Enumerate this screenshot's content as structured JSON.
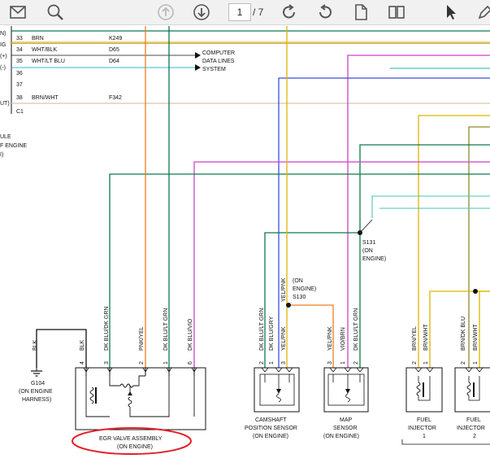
{
  "toolbar": {
    "current_page": "1",
    "total_pages": "/ 7",
    "icons": [
      "mail-icon",
      "zoom-icon",
      "page-up-icon",
      "page-down-icon",
      "rotate-clockwise-icon",
      "rotate-counterclockwise-icon",
      "single-page-icon",
      "two-page-icon",
      "select-cursor-icon",
      "pen-icon"
    ]
  },
  "colors": {
    "brn": "#c8a878",
    "green": "#0a7a4a",
    "orange": "#f07c20",
    "blue": "#3a4fd8",
    "magenta": "#d040c8",
    "yellow": "#e0b400",
    "olive": "#8a8a30",
    "teal": "#40c8b8",
    "cyan": "#30b8d8",
    "black": "#111111",
    "circle": "#e0202a"
  },
  "connector": {
    "left_pin_labels": [
      "N)",
      "IG",
      "(+)",
      "(-)",
      "",
      "",
      "UT)"
    ],
    "rows": [
      {
        "pin": "33",
        "color": "BRN",
        "circuit": "K249"
      },
      {
        "pin": "34",
        "color": "WHT/BLK",
        "circuit": "D65"
      },
      {
        "pin": "35",
        "color": "WHT/LT BLU",
        "circuit": "D64"
      },
      {
        "pin": "36",
        "color": "",
        "circuit": ""
      },
      {
        "pin": "37",
        "color": "",
        "circuit": ""
      },
      {
        "pin": "38",
        "color": "BRN/WHT",
        "circuit": "F342"
      }
    ],
    "connector_id": "C1",
    "module_text": [
      "ULE",
      "F ENGINE",
      "I)"
    ]
  },
  "computer_data_lines": [
    "COMPUTER",
    "DATA LINES",
    "SYSTEM"
  ],
  "splices": {
    "s131": [
      "S131",
      "(ON",
      "ENGINE)"
    ],
    "s130": [
      "(ON",
      "ENGINE)",
      "S130"
    ]
  },
  "ground": {
    "wire": "BLK",
    "id": "G104",
    "loc": [
      "(ON ENGINE",
      "HARNESS)"
    ]
  },
  "egr": {
    "pins": [
      {
        "num": "4",
        "wire": "BLK"
      },
      {
        "num": "3",
        "wire": "DK BLU/DK GRN"
      },
      {
        "num": "2",
        "wire": "PNK/YEL"
      },
      {
        "num": "1",
        "wire": "DK BLU/LT GRN"
      },
      {
        "num": "6",
        "wire": "DK BLU/VIO"
      }
    ],
    "name": "EGR VALVE ASSEMBLY",
    "loc": "(ON ENGINE)"
  },
  "camshaft": {
    "pins": [
      {
        "num": "2",
        "wire": "DK BLU/LT GRN"
      },
      {
        "num": "1",
        "wire": "DK BLU/GRY"
      },
      {
        "num": "3",
        "wire": "YEL/PNK"
      }
    ],
    "upper_wire": "YEL/PNK",
    "name": [
      "CAMSHAFT",
      "POSITION SENSOR",
      "(ON ENGINE)"
    ]
  },
  "map_sensor": {
    "pins": [
      {
        "num": "3",
        "wire": "YEL/PNK"
      },
      {
        "num": "1",
        "wire": "VIO/BRN"
      },
      {
        "num": "2",
        "wire": "DK BLU/LT GRN"
      }
    ],
    "name": [
      "MAP",
      "SENSOR",
      "(ON ENGINE)"
    ]
  },
  "injector1": {
    "pins": [
      {
        "num": "2",
        "wire": "BRN/YEL"
      },
      {
        "num": "1",
        "wire": "BRN/WHT"
      }
    ],
    "name": [
      "FUEL",
      "INJECTOR",
      "1"
    ]
  },
  "injector2": {
    "pins": [
      {
        "num": "2",
        "wire": "BRN/DK BLU"
      },
      {
        "num": "1",
        "wire": "BRN/WHT"
      }
    ],
    "name": [
      "FUEL",
      "INJECTOR",
      "2"
    ]
  }
}
